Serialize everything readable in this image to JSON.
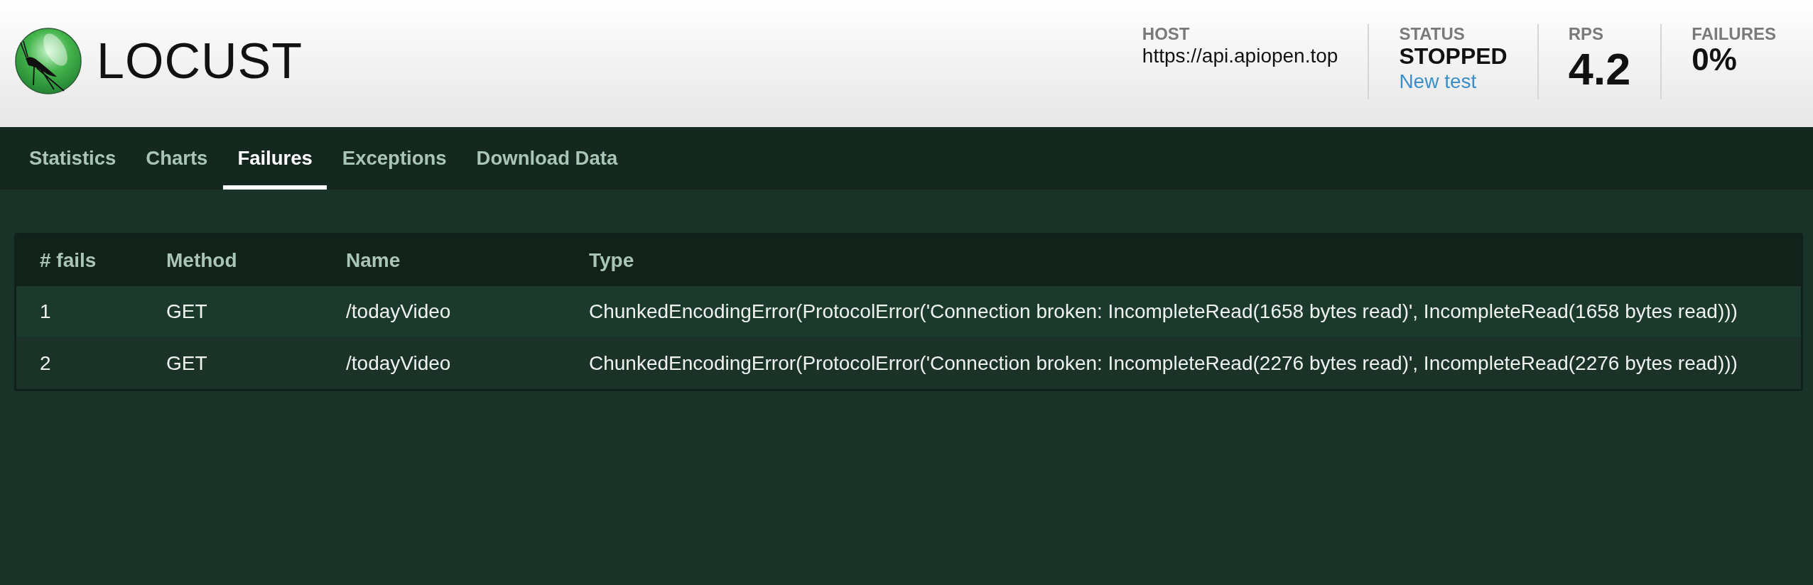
{
  "header": {
    "logo_text": "LOCUST",
    "stats": [
      {
        "kind": "host",
        "label": "HOST",
        "value": "https://api.apiopen.top"
      },
      {
        "kind": "status",
        "label": "STATUS",
        "value": "STOPPED",
        "link": "New test"
      },
      {
        "kind": "big",
        "label": "RPS",
        "value": "4.2"
      },
      {
        "kind": "medium",
        "label": "FAILURES",
        "value": "0%"
      }
    ]
  },
  "tabs": [
    {
      "label": "Statistics",
      "selected": false
    },
    {
      "label": "Charts",
      "selected": false
    },
    {
      "label": "Failures",
      "selected": true
    },
    {
      "label": "Exceptions",
      "selected": false
    },
    {
      "label": "Download Data",
      "selected": false
    }
  ],
  "table": {
    "columns": [
      "# fails",
      "Method",
      "Name",
      "Type"
    ],
    "rows": [
      [
        "1",
        "GET",
        "/todayVideo",
        "ChunkedEncodingError(ProtocolError('Connection broken: IncompleteRead(1658 bytes read)', IncompleteRead(1658 bytes read)))"
      ],
      [
        "2",
        "GET",
        "/todayVideo",
        "ChunkedEncodingError(ProtocolError('Connection broken: IncompleteRead(2276 bytes read)', IncompleteRead(2276 bytes read)))"
      ]
    ]
  }
}
